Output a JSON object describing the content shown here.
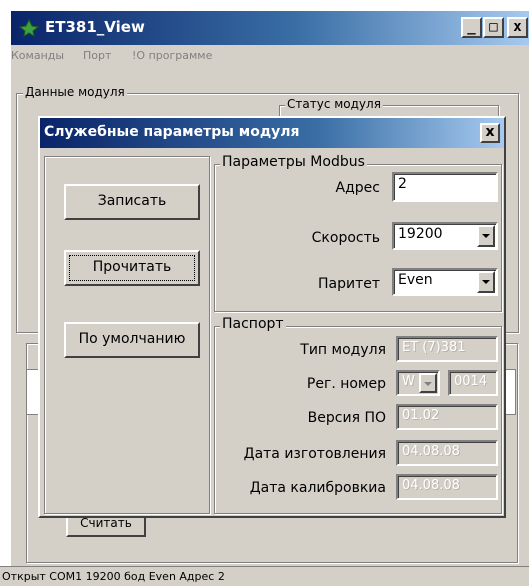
{
  "app": {
    "title": "ET381_View",
    "controls": {
      "minimize": "_",
      "maximize": "□",
      "close": "x"
    }
  },
  "menu": {
    "items": [
      "Команды",
      "Порт",
      "!О программе"
    ]
  },
  "main": {
    "group_data": "Данные модуля",
    "group_status": "Статус модуля",
    "read_button": "Считать"
  },
  "dialog": {
    "title": "Служебные параметры модуля",
    "close": "x",
    "buttons": {
      "write": "Записать",
      "read": "Прочитать",
      "defaults": "По умолчанию"
    },
    "modbus": {
      "title": "Параметры Modbus",
      "address_label": "Адрес",
      "address_value": "2",
      "speed_label": "Скорость",
      "speed_value": "19200",
      "parity_label": "Паритет",
      "parity_value": "Even"
    },
    "passport": {
      "title": "Паспорт",
      "type_label": "Тип модуля",
      "type_value": "ET (7)381",
      "reg_label": "Рег. номер",
      "reg_prefix": "W",
      "reg_value": "0014",
      "fw_label": "Версия ПО",
      "fw_value": "01.02",
      "mfg_label": "Дата изготовления",
      "mfg_value": "04.08.08",
      "cal_label": "Дата калибровкиа",
      "cal_value": "04.08.08"
    }
  },
  "statusbar": {
    "text": "Открыт COM1  19200 бод Even Адрес 2"
  }
}
